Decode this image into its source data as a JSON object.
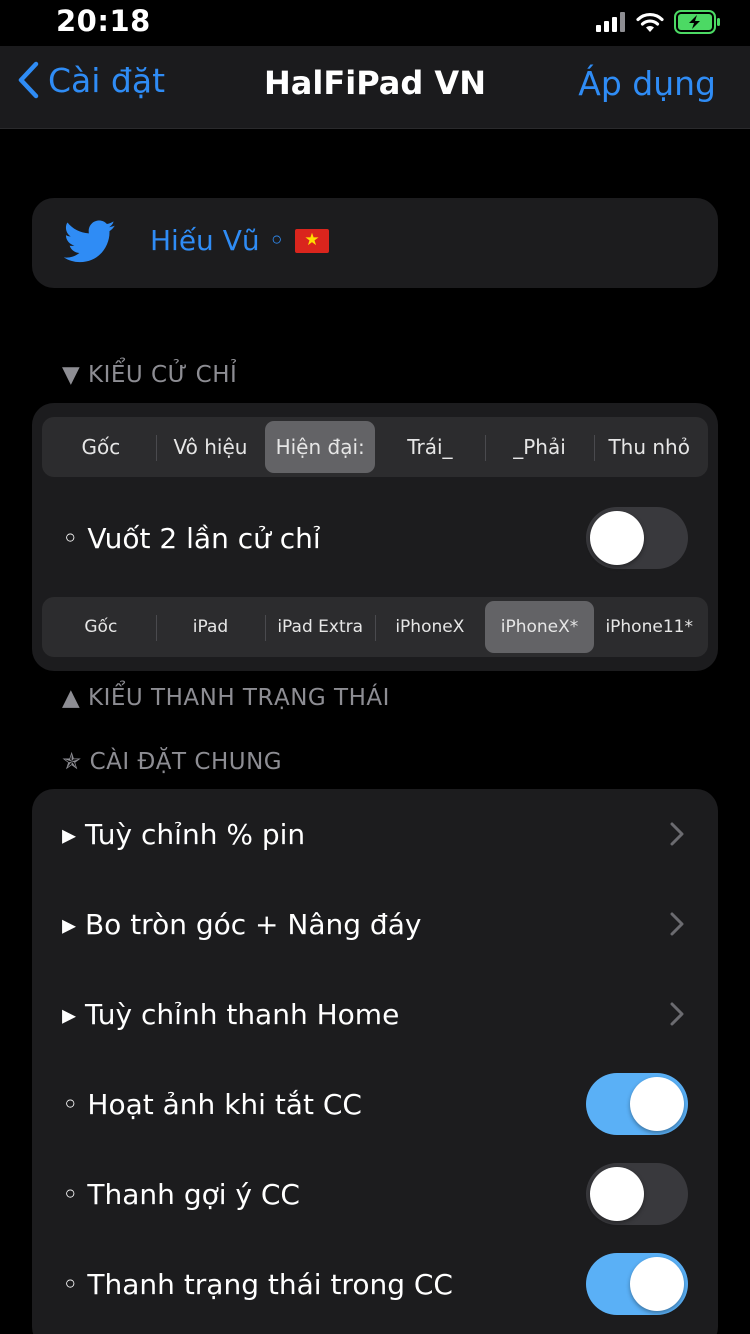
{
  "status_bar": {
    "time": "20:18"
  },
  "nav": {
    "back_label": "Cài đặt",
    "title": "HalFiPad VN",
    "apply_label": "Áp dụng"
  },
  "twitter": {
    "name": "Hiếu Vũ ◦"
  },
  "gesture_section": {
    "header": "▼ KIỂU CỬ CHỈ",
    "style_options": [
      "Gốc",
      "Vô hiệu",
      "Hiện đại:",
      "Trái_",
      "_Phải",
      "Thu nhỏ"
    ],
    "style_selected": "Hiện đại:",
    "double_swipe_label": "◦ Vuốt 2 lần cử chỉ",
    "double_swipe_on": false,
    "device_options": [
      "Gốc",
      "iPad",
      "iPad Extra",
      "iPhoneX",
      "iPhoneX*",
      "iPhone11*"
    ],
    "device_selected": "iPhoneX*"
  },
  "status_bar_section": {
    "header": "▲ KIỂU THANH TRẠNG THÁI"
  },
  "general_section": {
    "header": "✯ CÀI ĐẶT CHUNG",
    "items": [
      {
        "label": "▸ Tuỳ chỉnh % pin",
        "type": "link"
      },
      {
        "label": "▸ Bo tròn góc + Nâng đáy",
        "type": "link"
      },
      {
        "label": "▸ Tuỳ chỉnh thanh Home",
        "type": "link"
      },
      {
        "label": "◦ Hoạt ảnh khi tắt CC",
        "type": "toggle",
        "on": true
      },
      {
        "label": "◦ Thanh gợi ý CC",
        "type": "toggle",
        "on": false
      },
      {
        "label": "◦ Thanh trạng thái trong CC",
        "type": "toggle",
        "on": true
      }
    ]
  },
  "colors": {
    "accent": "#2f8cf5",
    "toggle_on": "#5ab0f6",
    "card": "#1c1c1e",
    "battery": "#4cd964",
    "flag_red": "#da251d",
    "flag_star": "#ffde00"
  }
}
